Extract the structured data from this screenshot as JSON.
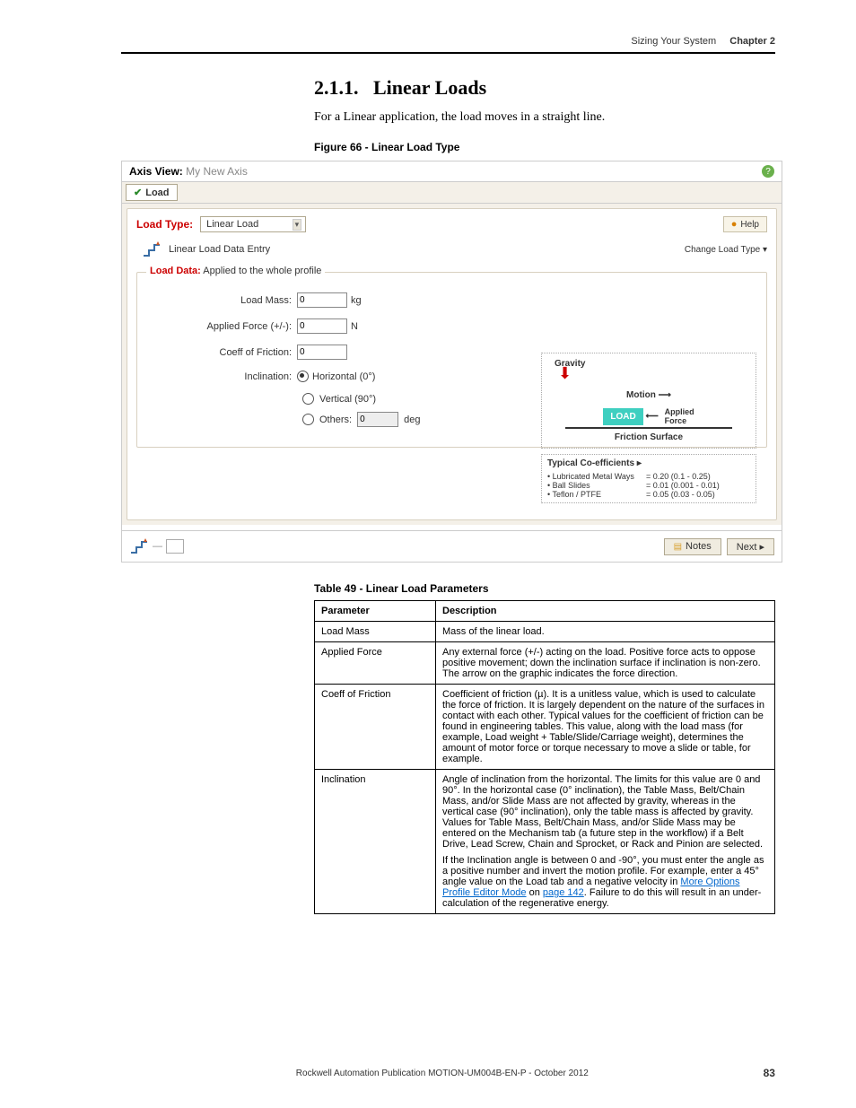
{
  "header": {
    "title": "Sizing Your System",
    "chapter": "Chapter 2"
  },
  "section": {
    "number": "2.1.1.",
    "title": "Linear Loads"
  },
  "intro": "For a Linear application, the load moves in a straight line.",
  "figure_caption": "Figure 66 - Linear Load Type",
  "screenshot": {
    "axis_view_label": "Axis View:",
    "axis_view_value": "My New Axis",
    "tab_label": "Load",
    "load_type_label": "Load Type:",
    "load_type_value": "Linear Load",
    "help_label": "Help",
    "entry_title": "Linear Load Data Entry",
    "change_load_type": "Change Load Type ▾",
    "fieldset_label_bold": "Load Data:",
    "fieldset_label_rest": "Applied to the whole profile",
    "fields": {
      "load_mass": {
        "label": "Load Mass:",
        "value": "0",
        "unit": "kg"
      },
      "applied_force": {
        "label": "Applied Force (+/-):",
        "value": "0",
        "unit": "N"
      },
      "coeff_friction": {
        "label": "Coeff of Friction:",
        "value": "0",
        "unit": ""
      },
      "inclination_label": "Inclination:",
      "horizontal": "Horizontal (0°)",
      "vertical": "Vertical (90°)",
      "others": "Others:",
      "others_value": "0",
      "others_unit": "deg"
    },
    "diagram": {
      "gravity": "Gravity",
      "motion": "Motion ⟶",
      "load": "LOAD",
      "applied_force": "Applied\nForce",
      "arrow_left": "⟵",
      "friction_surface": "Friction Surface",
      "coeff_title": "Typical Co-efficients ▸",
      "coeff1_name": "• Lubricated Metal Ways",
      "coeff1_val": "= 0.20 (0.1 - 0.25)",
      "coeff2_name": "• Ball Slides",
      "coeff2_val": "= 0.01 (0.001 - 0.01)",
      "coeff3_name": "• Teflon / PTFE",
      "coeff3_val": "= 0.05 (0.03 - 0.05)"
    },
    "notes_btn": "Notes",
    "next_btn": "Next ▸"
  },
  "table_title": "Table 49 - Linear Load Parameters",
  "table": {
    "header_param": "Parameter",
    "header_desc": "Description",
    "rows": [
      {
        "param": "Load Mass",
        "desc": "Mass of the linear load."
      },
      {
        "param": "Applied Force",
        "desc": "Any external force (+/-) acting on the load. Positive force acts to oppose positive movement; down the inclination surface if inclination is non-zero. The arrow on the graphic indicates the force direction."
      },
      {
        "param": "Coeff of Friction",
        "desc": "Coefficient of friction (µ). It is a unitless value, which is used to calculate the force of friction. It is largely dependent on the nature of the surfaces in contact with each other. Typical values for the coefficient of friction can be found in engineering tables. This value, along with the load mass (for example, Load weight + Table/Slide/Carriage weight), determines the amount of motor force or torque necessary to move a slide or table, for example."
      }
    ],
    "inclination": {
      "param": "Inclination",
      "p1": "Angle of inclination from the horizontal. The limits for this value are 0 and 90°. In the horizontal case (0° inclination), the Table Mass, Belt/Chain Mass, and/or Slide Mass are not affected by gravity, whereas in the vertical case (90° inclination), only the table mass is affected by gravity. Values for Table Mass, Belt/Chain Mass, and/or Slide Mass may be entered on the Mechanism tab (a future step in the workflow) if a Belt Drive, Lead Screw, Chain and Sprocket, or Rack and Pinion are selected.",
      "p2a": "If the Inclination angle is between 0 and -90°, you must enter the angle as a positive number and invert the motion profile. For example, enter a 45° angle value on the Load tab and a negative velocity in ",
      "link": "More Options Profile Editor Mode",
      "p2b": " on ",
      "pagelink": "page 142",
      "p2c": ". Failure to do this will result in an under-calculation of the regenerative energy."
    }
  },
  "footer": {
    "publication": "Rockwell Automation Publication MOTION-UM004B-EN-P - October 2012",
    "page": "83"
  }
}
